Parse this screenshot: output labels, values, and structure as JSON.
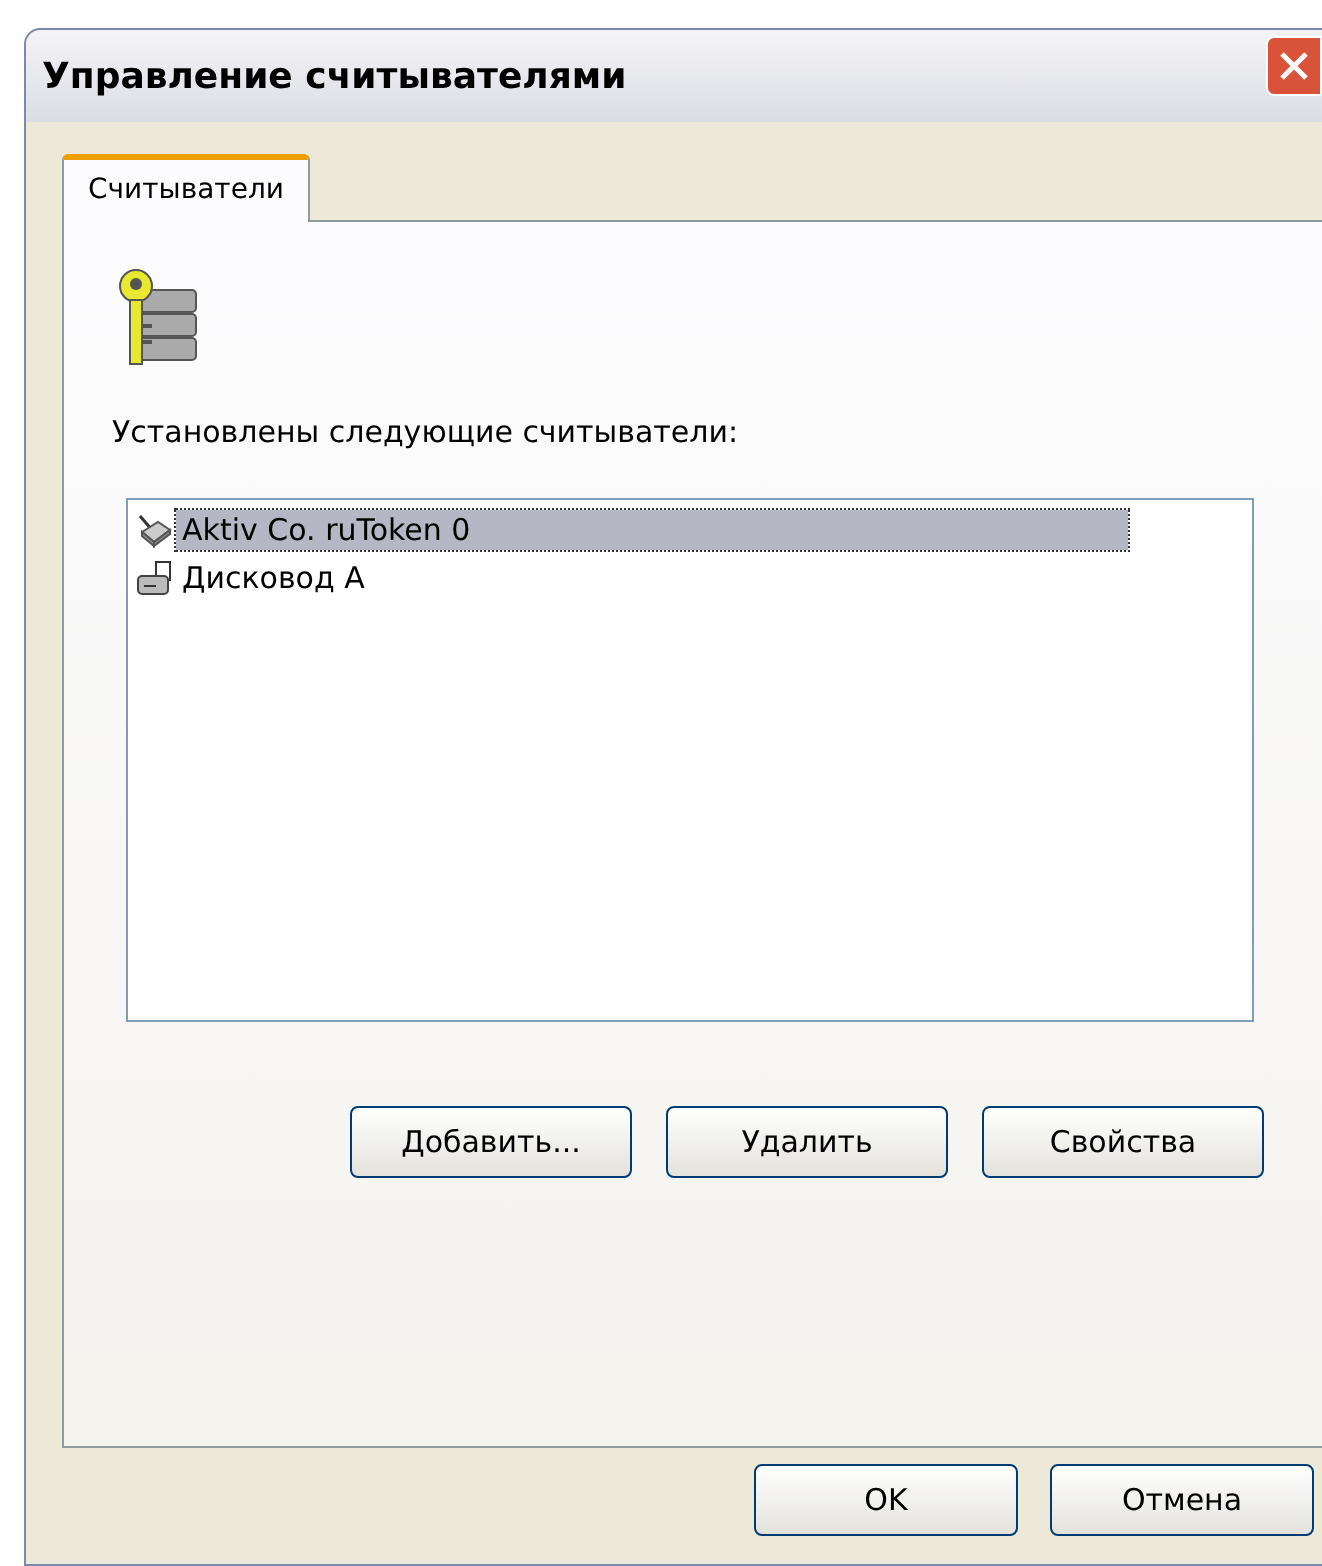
{
  "window": {
    "title": "Управление считывателями"
  },
  "tabs": [
    {
      "label": "Считыватели",
      "selected": true
    }
  ],
  "readers_label": "Установлены следующие считыватели:",
  "readers": [
    {
      "name": "Aktiv Co. ruToken 0",
      "kind": "token",
      "selected": true
    },
    {
      "name": "Дисковод A",
      "kind": "drive",
      "selected": false
    }
  ],
  "actions": [
    "Добавить...",
    "Удалить",
    "Свойства"
  ],
  "buttons": [
    "OK",
    "Отмена"
  ]
}
